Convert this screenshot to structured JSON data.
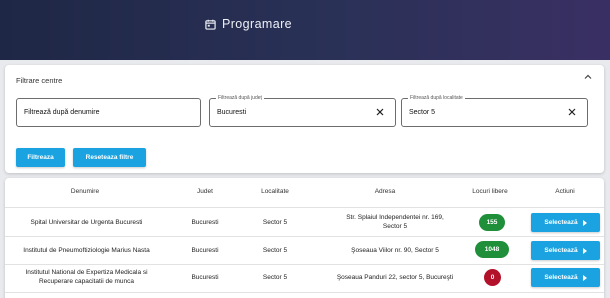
{
  "header": {
    "title": "Programare",
    "icon": "calendar-icon"
  },
  "filters": {
    "title": "Filtrare centre",
    "name_field": {
      "placeholder": "Filtrează după denumire"
    },
    "county_field": {
      "legend": "Filtrează după județ",
      "value": "Bucuresti"
    },
    "locality_field": {
      "legend": "Filtrează după localitate",
      "value": "Sector 5"
    },
    "filter_button": "Filtreaza",
    "reset_button": "Reseteaza filtre"
  },
  "table": {
    "columns": [
      "Denumire",
      "Judet",
      "Localitate",
      "Adresa",
      "Locuri libere",
      "Actiuni"
    ],
    "rows": [
      {
        "name_line1": "Spital Universitar de Urgenta Bucuresti",
        "name_line2": "",
        "county": "Bucuresti",
        "locality": "Sector 5",
        "address_line1": "Str. Splaiul Independentei nr. 169,",
        "address_line2": "Sector 5",
        "free_spots": "155",
        "badge_color": "#1f8f3a",
        "action": "Selectează"
      },
      {
        "name_line1": "Institutul de Pneumoftiziologie Marius Nasta",
        "name_line2": "",
        "county": "Bucuresti",
        "locality": "Sector 5",
        "address_line1": "Şoseaua Viilor nr. 90, Sector 5",
        "address_line2": "",
        "free_spots": "1048",
        "badge_color": "#1f8f3a",
        "action": "Selectează"
      },
      {
        "name_line1": "Institutul National de Expertiza Medicala si",
        "name_line2": "Recuperare capacitatii de munca",
        "county": "Bucuresti",
        "locality": "Sector 5",
        "address_line1": "Şoseaua Panduri 22, sector 5, Bucureşti",
        "address_line2": "",
        "free_spots": "0",
        "badge_color": "#b3102a",
        "action": "Selectează"
      }
    ]
  }
}
